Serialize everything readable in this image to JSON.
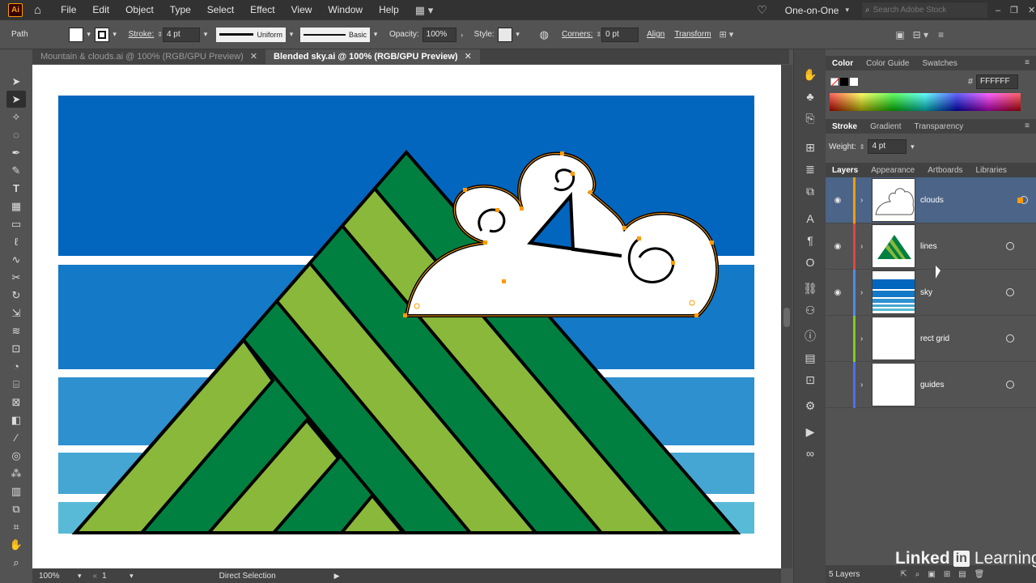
{
  "app": {
    "logo": "Ai"
  },
  "menu": [
    "File",
    "Edit",
    "Object",
    "Type",
    "Select",
    "Effect",
    "View",
    "Window",
    "Help"
  ],
  "workspace": "One-on-One",
  "search_placeholder": "Search Adobe Stock",
  "control": {
    "selection_type": "Path",
    "stroke_label": "Stroke:",
    "stroke_weight": "4 pt",
    "profile": "Uniform",
    "brush": "Basic",
    "opacity_label": "Opacity:",
    "opacity": "100%",
    "style_label": "Style:",
    "corners_label": "Corners:",
    "corners": "0 pt",
    "align": "Align",
    "transform": "Transform"
  },
  "tabs": [
    {
      "label": "Mountain & clouds.ai @ 100% (RGB/GPU Preview)",
      "active": false
    },
    {
      "label": "Blended sky.ai @ 100% (RGB/GPU Preview)",
      "active": true
    }
  ],
  "panels": {
    "color_tabs": [
      "Color",
      "Color Guide",
      "Swatches"
    ],
    "hex_value": "FFFFFF",
    "stroke_tabs": [
      "Stroke",
      "Gradient",
      "Transparency"
    ],
    "weight_label": "Weight:",
    "weight_value": "4 pt",
    "layer_tabs": [
      "Layers",
      "Appearance",
      "Artboards",
      "Libraries"
    ],
    "layers": [
      {
        "name": "clouds",
        "color": "#ff9a00"
      },
      {
        "name": "lines",
        "color": "#e0473f"
      },
      {
        "name": "sky",
        "color": "#4a8cf0"
      },
      {
        "name": "rect grid",
        "color": "#7fcc1f"
      },
      {
        "name": "guides",
        "color": "#4b6ff0"
      }
    ],
    "layer_count": "5 Layers"
  },
  "status": {
    "zoom": "100%",
    "artboard": "1",
    "tool": "Direct Selection"
  },
  "colors": {
    "sky_top": "#0266bf",
    "sky_2": "#1479c6",
    "sky_3": "#2e90cf",
    "sky_4": "#45a5d3",
    "sky_5": "#58bad6",
    "green_dark": "#008040",
    "green_light": "#8ab83a",
    "selection": "#ff9a00"
  },
  "watermark": {
    "brand": "Linked",
    "in": "in",
    "product": "Learning"
  }
}
